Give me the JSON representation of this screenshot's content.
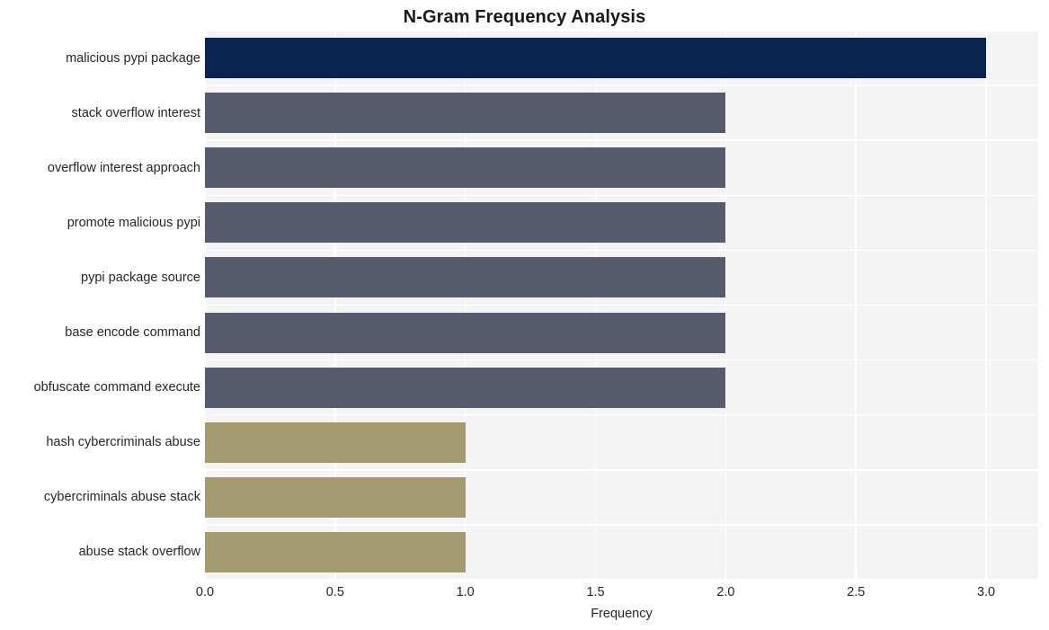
{
  "chart_data": {
    "type": "bar",
    "orientation": "horizontal",
    "title": "N-Gram Frequency Analysis",
    "xlabel": "Frequency",
    "ylabel": "",
    "xlim": [
      0.0,
      3.2
    ],
    "xticks": [
      "0.0",
      "0.5",
      "1.0",
      "1.5",
      "2.0",
      "2.5",
      "3.0"
    ],
    "xtick_values": [
      0.0,
      0.5,
      1.0,
      1.5,
      2.0,
      2.5,
      3.0
    ],
    "grid": true,
    "legend": "none",
    "categories": [
      "malicious pypi package",
      "stack overflow interest",
      "overflow interest approach",
      "promote malicious pypi",
      "pypi package source",
      "base encode command",
      "obfuscate command execute",
      "hash cybercriminals abuse",
      "cybercriminals abuse stack",
      "abuse stack overflow"
    ],
    "values": [
      3,
      2,
      2,
      2,
      2,
      2,
      2,
      1,
      1,
      1
    ],
    "bar_colors": [
      "#0a2350",
      "#565c6d",
      "#565c6d",
      "#565c6d",
      "#565c6d",
      "#565c6d",
      "#565c6d",
      "#a39a70",
      "#a39a70",
      "#a39a70"
    ]
  },
  "style": {
    "plot_background": "#f4f4f5",
    "figure_background": "#ffffff",
    "gridline_color": "#ffffff",
    "text_color": "#262626",
    "title_color": "#1a1a1a"
  }
}
